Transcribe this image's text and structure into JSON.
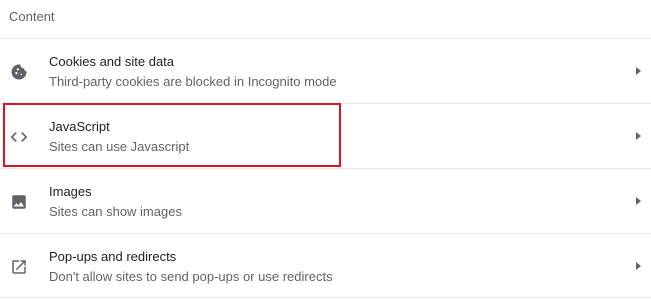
{
  "section": {
    "title": "Content"
  },
  "items": [
    {
      "title": "Cookies and site data",
      "subtitle": "Third-party cookies are blocked in Incognito mode",
      "icon": "cookie-icon"
    },
    {
      "title": "JavaScript",
      "subtitle": "Sites can use Javascript",
      "icon": "code-icon"
    },
    {
      "title": "Images",
      "subtitle": "Sites can show images",
      "icon": "image-icon"
    },
    {
      "title": "Pop-ups and redirects",
      "subtitle": "Don't allow sites to send pop-ups or use redirects",
      "icon": "open-in-new-icon"
    }
  ],
  "colors": {
    "highlight": "#e0121b",
    "icon": "#5f6368",
    "title_text": "#202124",
    "subtitle_text": "#5f6368"
  }
}
